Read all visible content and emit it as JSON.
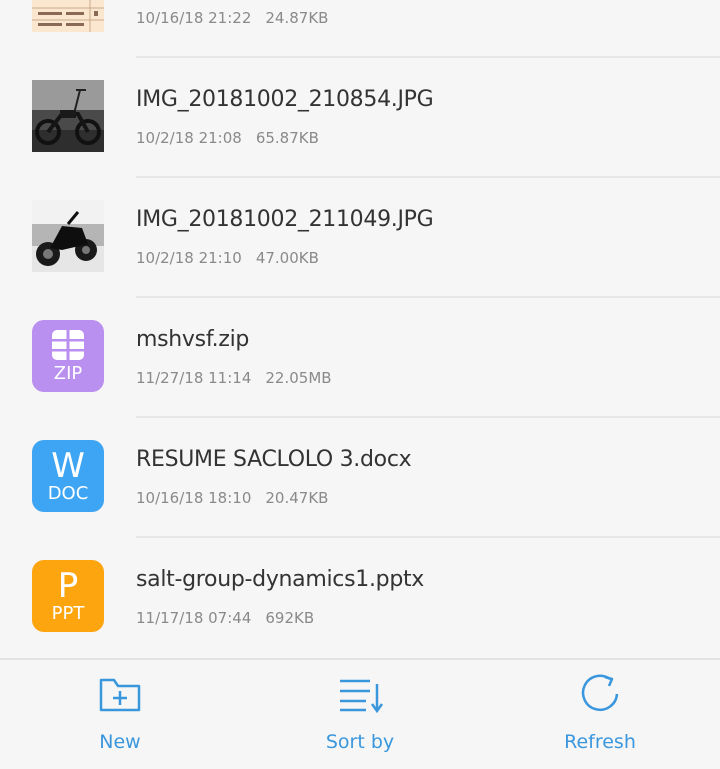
{
  "files": [
    {
      "name": "",
      "date": "10/16/18 21:22",
      "size": "24.87KB",
      "icon": "spreadsheet-thumbnail"
    },
    {
      "name": "IMG_20181002_210854.JPG",
      "date": "10/2/18 21:08",
      "size": "65.87KB",
      "icon": "motorcycle-photo-thumbnail"
    },
    {
      "name": "IMG_20181002_211049.JPG",
      "date": "10/2/18 21:10",
      "size": "47.00KB",
      "icon": "motorcycle-photo-thumbnail"
    },
    {
      "name": "mshvsf.zip",
      "date": "11/27/18 11:14",
      "size": "22.05MB",
      "icon": "zip-icon",
      "icon_ext": "ZIP"
    },
    {
      "name": "RESUME SACLOLO 3.docx",
      "date": "10/16/18 18:10",
      "size": "20.47KB",
      "icon": "word-icon",
      "icon_letter": "W",
      "icon_ext": "DOC"
    },
    {
      "name": "salt-group-dynamics1.pptx",
      "date": "11/17/18 07:44",
      "size": "692KB",
      "icon": "powerpoint-icon",
      "icon_letter": "P",
      "icon_ext": "PPT"
    }
  ],
  "toolbar": {
    "new_label": "New",
    "sort_label": "Sort by",
    "refresh_label": "Refresh"
  },
  "colors": {
    "accent": "#3a97dd",
    "zip": "#b98ff0",
    "doc": "#3ea5f4",
    "ppt": "#fda50f"
  }
}
